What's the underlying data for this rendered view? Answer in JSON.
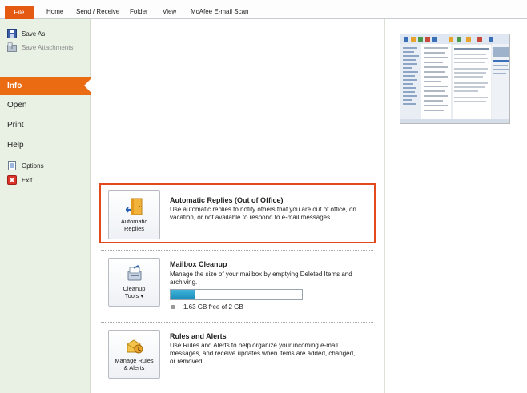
{
  "ribbon": {
    "tabs": [
      "File",
      "Home",
      "Send / Receive",
      "Folder",
      "View",
      "McAfee E-mail Scan"
    ]
  },
  "nav": {
    "save_as": "Save As",
    "save_attachments": "Save Attachments",
    "info": "Info",
    "open": "Open",
    "print": "Print",
    "help": "Help",
    "options": "Options",
    "exit": "Exit"
  },
  "auto_replies": {
    "button_line1": "Automatic",
    "button_line2": "Replies",
    "title": "Automatic Replies (Out of Office)",
    "description": "Use automatic replies to notify others that you are out of office, on vacation, or not available to respond to e-mail messages."
  },
  "mailbox_cleanup": {
    "button_line1": "Cleanup",
    "button_line2": "Tools ▾",
    "title": "Mailbox Cleanup",
    "description": "Manage the size of your mailbox by emptying Deleted Items and archiving.",
    "usage_fraction": 0.19,
    "free_text": "1.63 GB free of 2 GB"
  },
  "rules_alerts": {
    "button_line1": "Manage Rules",
    "button_line2": "& Alerts",
    "title": "Rules and Alerts",
    "description": "Use Rules and Alerts to help organize your incoming e-mail messages, and receive updates when items are added, changed, or removed."
  },
  "colors": {
    "accent": "#ea6b12",
    "highlight_border": "#e3491b",
    "nav_bg": "#e9f1e4",
    "bar_fill": "#1c8cb9"
  },
  "icons": {
    "save_as": "save-as-icon",
    "save_attachments": "save-attachments-icon",
    "options": "options-icon",
    "exit": "exit-icon",
    "auto_replies": "door-arrow-icon",
    "cleanup": "cleanup-tools-icon",
    "rules": "rules-alerts-icon"
  }
}
